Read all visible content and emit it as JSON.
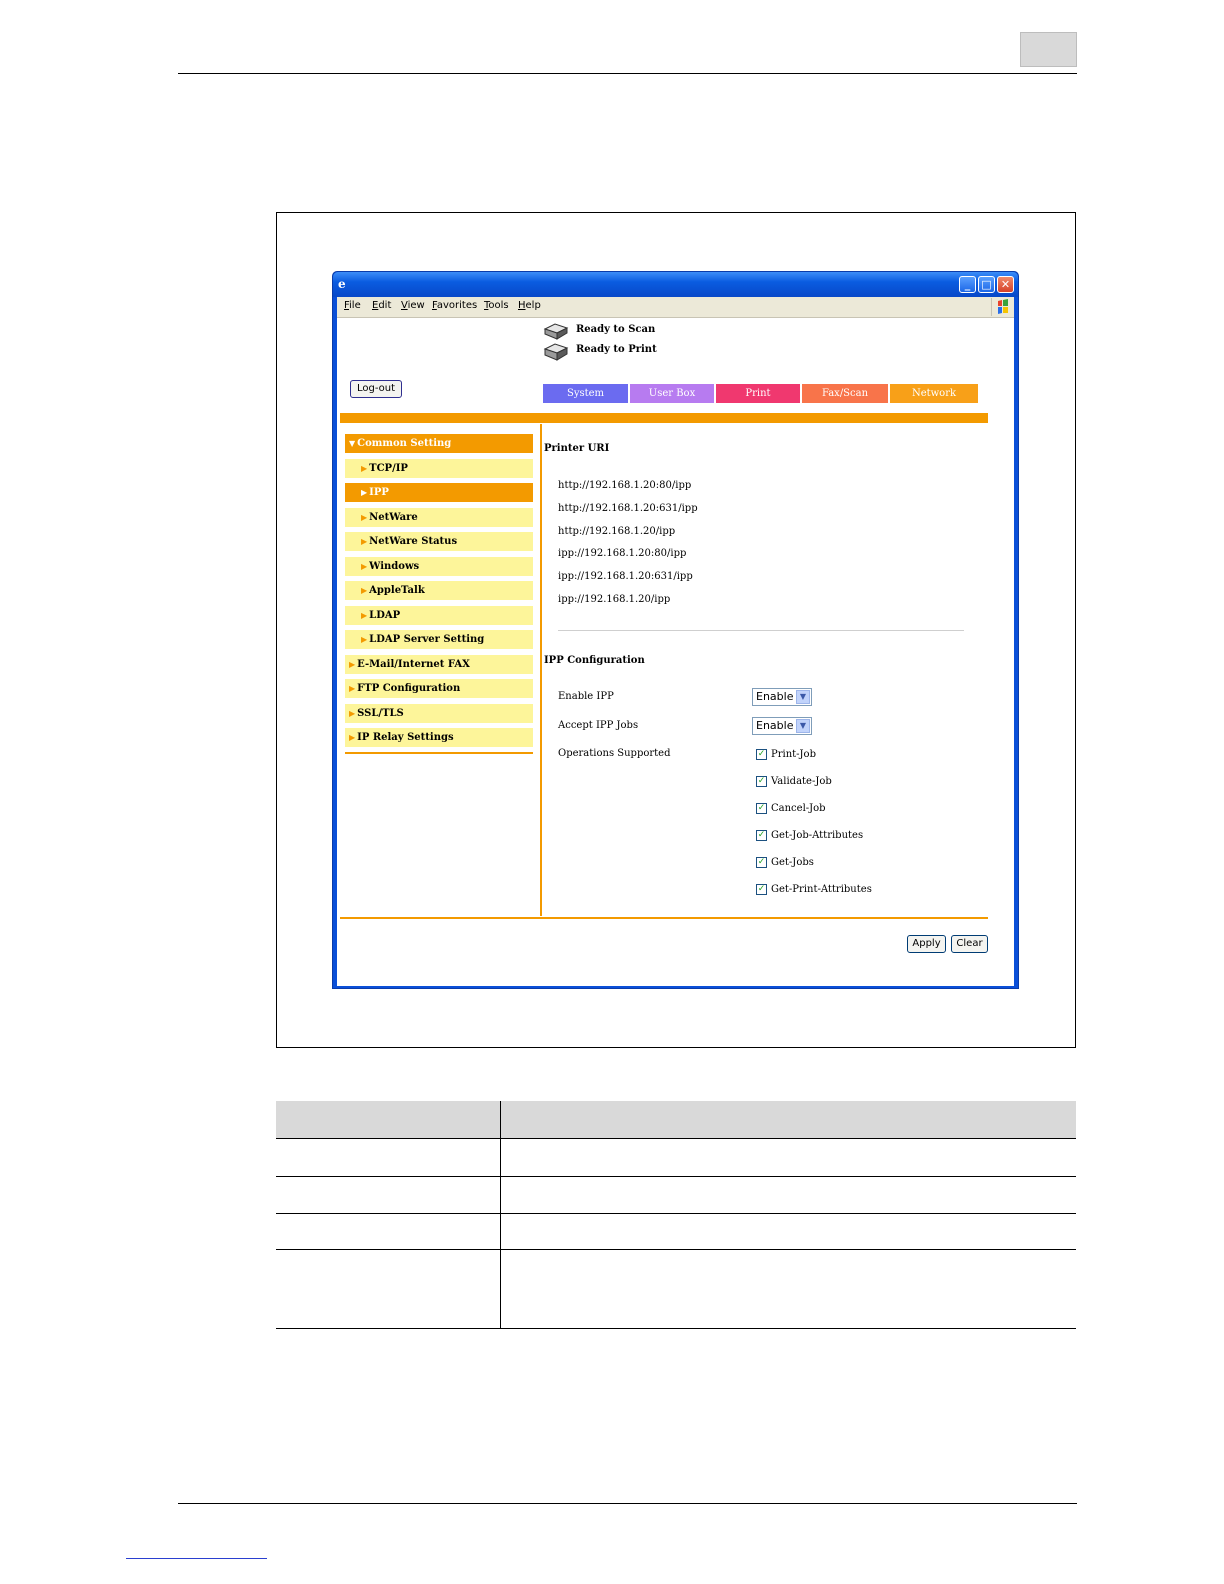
{
  "browser": {
    "menu": [
      "File",
      "Edit",
      "View",
      "Favorites",
      "Tools",
      "Help"
    ],
    "window_buttons": {
      "minimize": "_",
      "maximize": "□",
      "close": "✕"
    }
  },
  "status": {
    "scan": "Ready to Scan",
    "print": "Ready to Print"
  },
  "logout_label": "Log-out",
  "tabs": [
    {
      "label": "System",
      "color": "#6b6bf0"
    },
    {
      "label": "User Box",
      "color": "#b77bf0"
    },
    {
      "label": "Print",
      "color": "#f0386f"
    },
    {
      "label": "Fax/Scan",
      "color": "#f8744a"
    },
    {
      "label": "Network",
      "color": "#f8a018"
    }
  ],
  "sidebar": {
    "common_setting": "Common Setting",
    "sub_items": [
      "TCP/IP",
      "IPP",
      "NetWare",
      "NetWare Status",
      "Windows",
      "AppleTalk",
      "LDAP",
      "LDAP Server Setting"
    ],
    "selected": "IPP",
    "top_items": [
      "E-Mail/Internet FAX",
      "FTP Configuration",
      "SSL/TLS",
      "IP Relay Settings"
    ]
  },
  "printer_uri": {
    "title": "Printer URI",
    "uris": [
      "http://192.168.1.20:80/ipp",
      "http://192.168.1.20:631/ipp",
      "http://192.168.1.20/ipp",
      "ipp://192.168.1.20:80/ipp",
      "ipp://192.168.1.20:631/ipp",
      "ipp://192.168.1.20/ipp"
    ]
  },
  "ipp_config": {
    "title": "IPP Configuration",
    "enable_ipp_label": "Enable IPP",
    "enable_ipp_value": "Enable",
    "accept_jobs_label": "Accept IPP Jobs",
    "accept_jobs_value": "Enable",
    "operations_label": "Operations Supported",
    "operations": [
      "Print-Job",
      "Validate-Job",
      "Cancel-Job",
      "Get-Job-Attributes",
      "Get-Jobs",
      "Get-Print-Attributes"
    ]
  },
  "buttons": {
    "apply": "Apply",
    "clear": "Clear"
  }
}
